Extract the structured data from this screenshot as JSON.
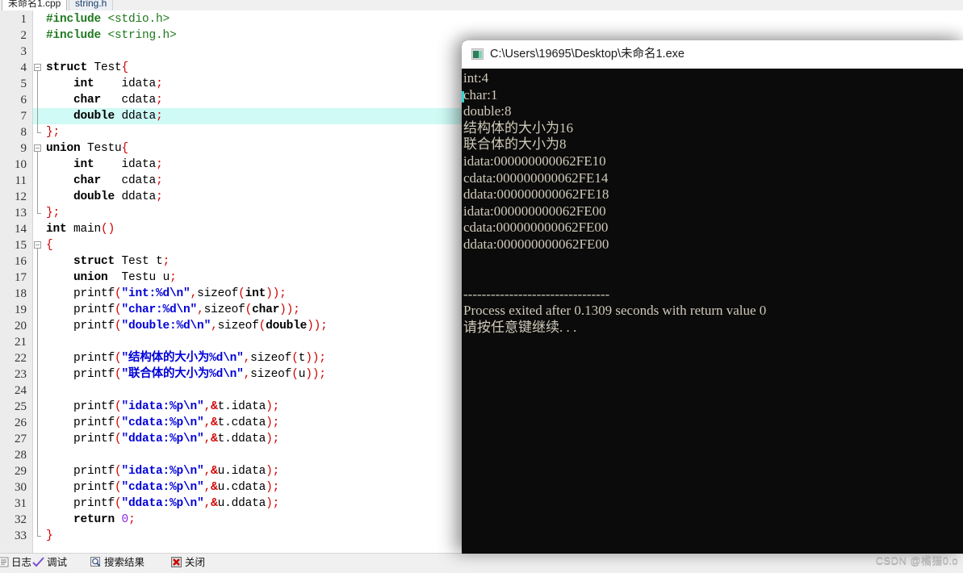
{
  "ide": {
    "tabs": [
      {
        "label": "未命名1.cpp",
        "active": true
      },
      {
        "label": "string.h",
        "active": false
      }
    ],
    "highlighted_line": 7,
    "bottom_tabs": [
      {
        "label": "日志",
        "icon": "log-icon"
      },
      {
        "label": "调试",
        "icon": "check-icon"
      },
      {
        "label": "搜索结果",
        "icon": "magnifier-icon"
      },
      {
        "label": "关闭",
        "icon": "close-red-icon"
      }
    ],
    "code_lines": [
      {
        "n": "1",
        "text": "#include <stdio.h>"
      },
      {
        "n": "2",
        "text": "#include <string.h>"
      },
      {
        "n": "3",
        "text": ""
      },
      {
        "n": "4",
        "text": "struct Test{"
      },
      {
        "n": "5",
        "text": "    int    idata;"
      },
      {
        "n": "6",
        "text": "    char   cdata;"
      },
      {
        "n": "7",
        "text": "    double ddata;"
      },
      {
        "n": "8",
        "text": "};"
      },
      {
        "n": "9",
        "text": "union Testu{"
      },
      {
        "n": "10",
        "text": "    int    idata;"
      },
      {
        "n": "11",
        "text": "    char   cdata;"
      },
      {
        "n": "12",
        "text": "    double ddata;"
      },
      {
        "n": "13",
        "text": "};"
      },
      {
        "n": "14",
        "text": "int main()"
      },
      {
        "n": "15",
        "text": "{"
      },
      {
        "n": "16",
        "text": "    struct Test t;"
      },
      {
        "n": "17",
        "text": "    union  Testu u;"
      },
      {
        "n": "18",
        "text": "    printf(\"int:%d\\n\",sizeof(int));"
      },
      {
        "n": "19",
        "text": "    printf(\"char:%d\\n\",sizeof(char));"
      },
      {
        "n": "20",
        "text": "    printf(\"double:%d\\n\",sizeof(double));"
      },
      {
        "n": "21",
        "text": ""
      },
      {
        "n": "22",
        "text": "    printf(\"结构体的大小为%d\\n\",sizeof(t));"
      },
      {
        "n": "23",
        "text": "    printf(\"联合体的大小为%d\\n\",sizeof(u));"
      },
      {
        "n": "24",
        "text": ""
      },
      {
        "n": "25",
        "text": "    printf(\"idata:%p\\n\",&t.idata);"
      },
      {
        "n": "26",
        "text": "    printf(\"cdata:%p\\n\",&t.cdata);"
      },
      {
        "n": "27",
        "text": "    printf(\"ddata:%p\\n\",&t.ddata);"
      },
      {
        "n": "28",
        "text": ""
      },
      {
        "n": "29",
        "text": "    printf(\"idata:%p\\n\",&u.idata);"
      },
      {
        "n": "30",
        "text": "    printf(\"cdata:%p\\n\",&u.cdata);"
      },
      {
        "n": "31",
        "text": "    printf(\"ddata:%p\\n\",&u.ddata);"
      },
      {
        "n": "32",
        "text": "    return 0;"
      },
      {
        "n": "33",
        "text": "}"
      }
    ]
  },
  "console": {
    "title": "C:\\Users\\19695\\Desktop\\未命名1.exe",
    "icon": "console-window-icon",
    "output": [
      "int:4",
      "char:1",
      "double:8",
      "结构体的大小为16",
      "联合体的大小为8",
      "idata:000000000062FE10",
      "cdata:000000000062FE14",
      "ddata:000000000062FE18",
      "idata:000000000062FE00",
      "cdata:000000000062FE00",
      "ddata:000000000062FE00",
      "",
      "",
      "--------------------------------",
      "Process exited after 0.1309 seconds with return value 0",
      "请按任意键继续. . ."
    ]
  },
  "watermark": {
    "text": "CSDN @橘猫0.o"
  },
  "colors": {
    "highlight_line": "#cffaf5",
    "string_token": "#0000d8",
    "punct_token": "#d00000",
    "preproc_token": "#1f7a1f",
    "console_bg": "#0b0b0b",
    "console_fg": "#cfc9b8"
  }
}
